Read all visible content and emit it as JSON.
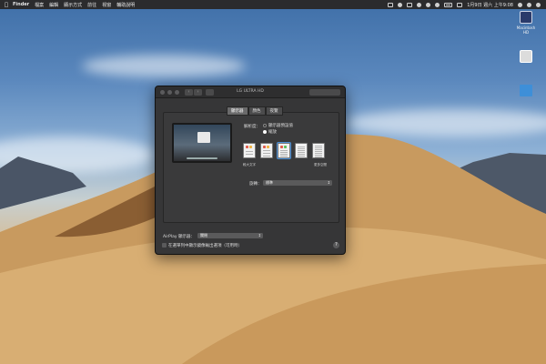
{
  "menubar": {
    "apple_icon": "apple-icon",
    "items": [
      "Finder",
      "檔案",
      "編輯",
      "顯示方式",
      "前往",
      "視窗",
      "輔助說明"
    ],
    "clock": "1月9日 週六 上午9:08"
  },
  "desktop": {
    "icons": [
      {
        "label": "Macintosh HD",
        "icon": "drive-icon"
      },
      {
        "label": "",
        "icon": "image-file-icon"
      },
      {
        "label": "",
        "icon": "folder-icon"
      }
    ]
  },
  "window": {
    "title": "LG ULTRA HD",
    "tabs": [
      "顯示器",
      "顏色",
      "夜覽"
    ],
    "active_tab": 0,
    "resolution_label": "解析度：",
    "resolution_options": [
      "顯示器預設值",
      "縮放"
    ],
    "resolution_selected": 1,
    "scale_captions": {
      "left": "較大文字",
      "right": "更多空間"
    },
    "rotation_label": "旋轉：",
    "rotation_value": "標準",
    "airplay_label": "AirPlay 顯示器：",
    "airplay_value": "關閉",
    "mirroring_checkbox_label": "在選單列中顯示鏡像輸出選項（可用時）",
    "help_label": "?"
  },
  "colors": {
    "accent": "#4a90d9",
    "window_bg": "#363637",
    "menubar_bg": "#2b2b2d"
  }
}
